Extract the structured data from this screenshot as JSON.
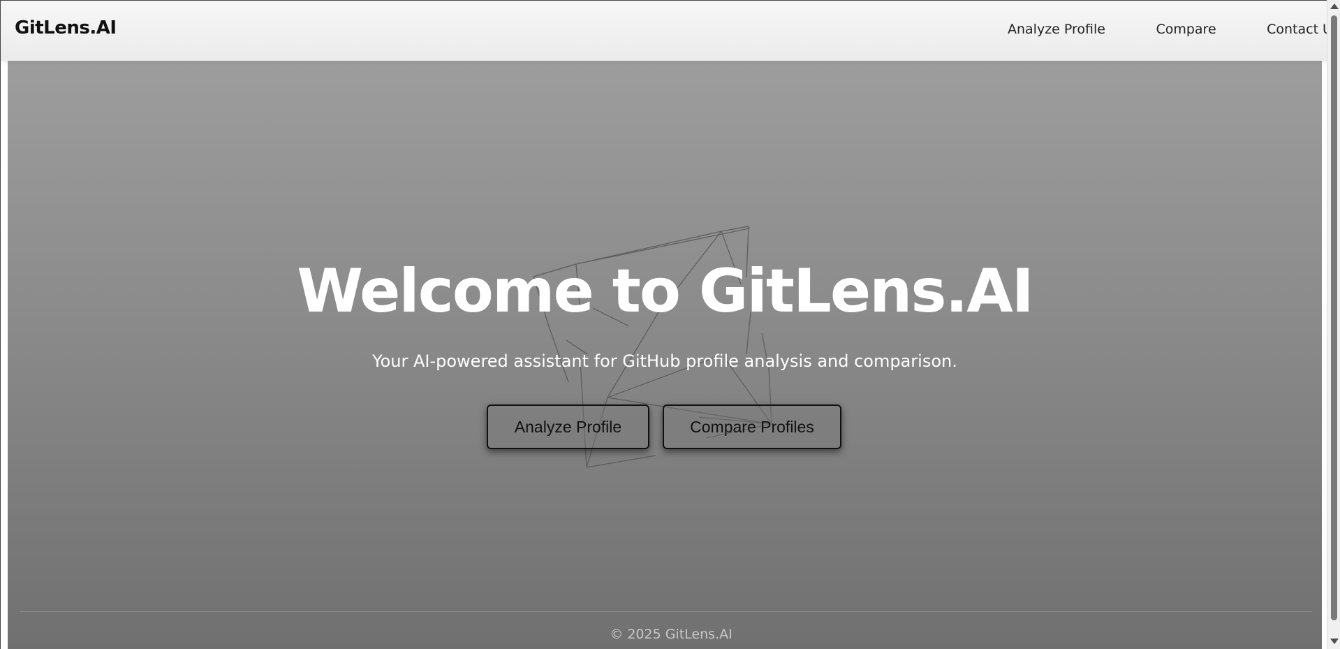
{
  "navbar": {
    "brand": "GitLens.AI",
    "links": [
      "Analyze Profile",
      "Compare",
      "Contact Us"
    ]
  },
  "hero": {
    "title": "Welcome to GitLens.AI",
    "subtitle": "Your AI-powered assistant for GitHub profile analysis and comparison.",
    "buttons": {
      "analyze": "Analyze Profile",
      "compare": "Compare Profiles"
    }
  },
  "footer": {
    "text": "© 2025 GitLens.AI"
  },
  "colors": {
    "hero_top": "#9d9d9d",
    "hero_bottom": "#707070",
    "title": "#ffffff",
    "navbar_bg": "#f2f2f2"
  }
}
